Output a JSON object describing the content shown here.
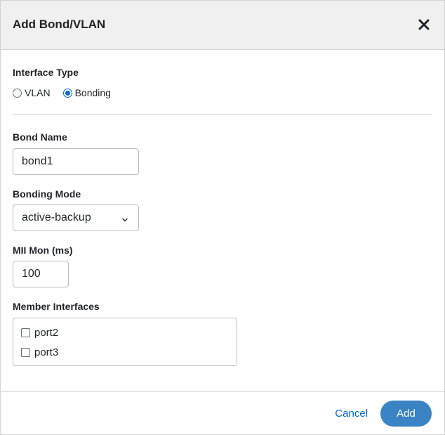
{
  "dialog": {
    "title": "Add Bond/VLAN"
  },
  "interface_type": {
    "label": "Interface Type",
    "options": [
      {
        "label": "VLAN",
        "checked": false
      },
      {
        "label": "Bonding",
        "checked": true
      }
    ]
  },
  "bond_name": {
    "label": "Bond Name",
    "value": "bond1"
  },
  "bonding_mode": {
    "label": "Bonding Mode",
    "value": "active-backup"
  },
  "mii_mon": {
    "label": "MII Mon (ms)",
    "value": "100"
  },
  "member_interfaces": {
    "label": "Member Interfaces",
    "items": [
      {
        "label": "port2",
        "checked": false
      },
      {
        "label": "port3",
        "checked": false
      }
    ]
  },
  "footer": {
    "cancel_label": "Cancel",
    "add_label": "Add"
  },
  "colors": {
    "accent": "#0066cc",
    "primary_button": "#3a83c4",
    "header_bg": "#f0f0f0"
  }
}
